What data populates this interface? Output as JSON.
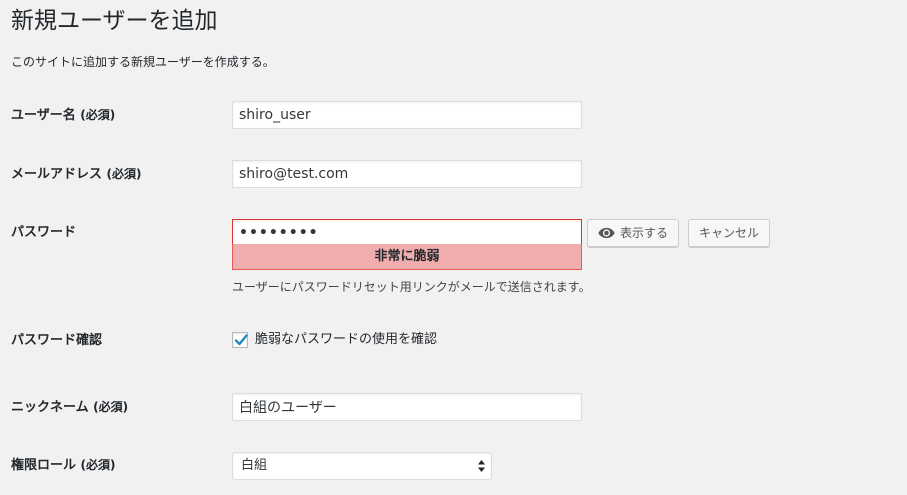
{
  "page": {
    "title": "新規ユーザーを追加",
    "description": "このサイトに追加する新規ユーザーを作成する。"
  },
  "form": {
    "username": {
      "label": "ユーザー名",
      "required": "(必須)",
      "value": "shiro_user"
    },
    "email": {
      "label": "メールアドレス",
      "required": "(必須)",
      "value": "shiro@test.com"
    },
    "password": {
      "label": "パスワード",
      "value": "••••••••",
      "show_button": "表示する",
      "cancel_button": "キャンセル",
      "strength": "非常に脆弱",
      "description": "ユーザーにパスワードリセット用リンクがメールで送信されます。"
    },
    "password_confirm": {
      "label": "パスワード確認",
      "checkbox_label": "脆弱なパスワードの使用を確認",
      "checked": true
    },
    "nickname": {
      "label": "ニックネーム",
      "required": "(必須)",
      "value": "白組のユーザー"
    },
    "role": {
      "label": "権限ロール",
      "required": "(必須)",
      "selected": "白組"
    }
  },
  "colors": {
    "background": "#f1f1f1",
    "strength_bad_bg": "#f1adad",
    "strength_bad_border": "#e35b5b",
    "checkbox_check": "#1e8cbe"
  },
  "icons": {
    "show_password": "eye-icon",
    "checkbox": "checkmark-icon",
    "select": "select-arrows-icon"
  }
}
